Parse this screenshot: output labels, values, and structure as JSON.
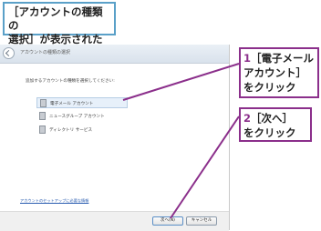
{
  "callout": {
    "line1": "［アカウントの種類の",
    "line2": "選択］が表示された"
  },
  "window": {
    "title": "アカウントの種類の選択",
    "instruction": "追加するアカウントの種類を選択してください:",
    "options": [
      {
        "label": "電子メール アカウント",
        "selected": true
      },
      {
        "label": "ニュースグループ アカウント",
        "selected": false
      },
      {
        "label": "ディレクトリ サービス",
        "selected": false
      }
    ],
    "setup_link": "アカウントのセットアップに必要な情報",
    "next_button": "次へ(N)",
    "cancel_button": "キャンセル"
  },
  "steps": [
    {
      "number": "1",
      "lines": [
        "［電子メール",
        "アカウント］",
        "をクリック"
      ]
    },
    {
      "number": "2",
      "lines": [
        "［次へ］",
        "をクリック"
      ]
    }
  ],
  "colors": {
    "step_border": "#8b2f8b",
    "callout_border": "#5aa0c8"
  }
}
